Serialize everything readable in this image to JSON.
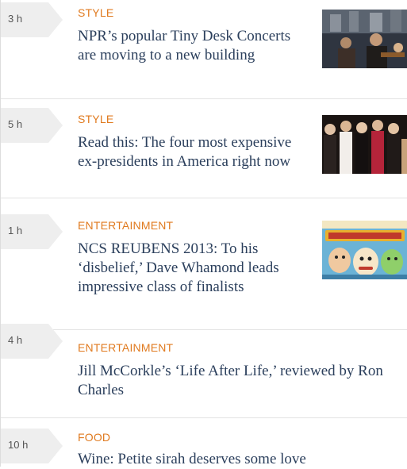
{
  "colors": {
    "category": "#e07a1f",
    "headline": "#2b3f5c",
    "time_tab": "#eeeeee",
    "divider": "#e2e2e2"
  },
  "items": [
    {
      "time": "3 h",
      "category": "STYLE",
      "headline": "NPR’s popular Tiny Desk Concerts are moving to a new building",
      "thumbnail": "concert-photo"
    },
    {
      "time": "5 h",
      "category": "STYLE",
      "headline": "Read this: The four most expensive ex-presidents in America right now",
      "thumbnail": "presidents-photo"
    },
    {
      "time": "1 h",
      "category": "ENTERTAINMENT",
      "headline": "NCS REUBENS 2013: To his ‘disbelief,’ Dave Whamond leads impressive class of finalists",
      "thumbnail": "reuben-awards-cartoon"
    },
    {
      "time": "4 h",
      "category": "ENTERTAINMENT",
      "headline": "Jill McCorkle’s ‘Life After Life,’ reviewed by Ron Charles"
    },
    {
      "time": "10 h",
      "category": "FOOD",
      "headline": "Wine: Petite sirah deserves some love"
    }
  ]
}
